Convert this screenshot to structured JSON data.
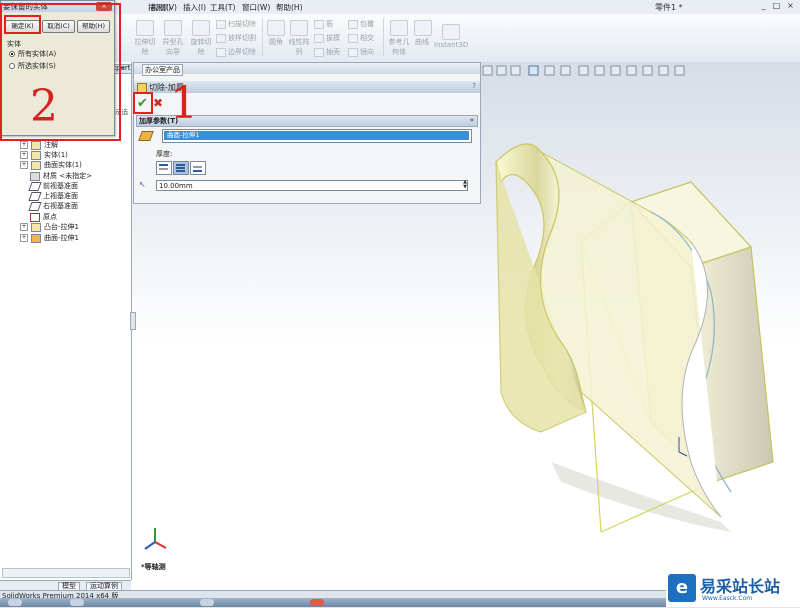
{
  "menubar": {
    "items": [
      "插入(I)",
      "视图(V)",
      "插入(I)",
      "工具(T)",
      "窗口(W)",
      "帮助(H)"
    ],
    "window_title": "零件1 *",
    "controls": [
      "_",
      "□",
      "×"
    ]
  },
  "ribbon": {
    "buttons": [
      "拉伸切除",
      "异型孔向导",
      "旋转切除",
      "圆角",
      "线性阵列",
      "参考几何体",
      "曲线",
      "Instant3D"
    ],
    "small_buttons": [
      "扫描切除",
      "放样切割",
      "边界切除",
      "筋",
      "拔模",
      "抽壳",
      "包覆",
      "相交",
      "镜向"
    ]
  },
  "dialog": {
    "title": "要保留的实体",
    "ok_label": "确定(K)",
    "cancel_label": "取消(C)",
    "help_label": "帮助(H)",
    "group_label": "实体",
    "option_all": "所有实体(A)",
    "option_selected": "所选实体(S)"
  },
  "left_panel": {
    "tabs_partial": [
      "xpert",
      "办公室产品"
    ],
    "side_label": "示选",
    "tree": [
      "注解",
      "实体(1)",
      "曲面实体(1)",
      "材质 <未指定>",
      "前视基准面",
      "上视基准面",
      "右视基准面",
      "原点",
      "凸台-拉伸1",
      "曲面-拉伸1"
    ],
    "bottom_tabs": [
      "模型",
      "运动算例"
    ]
  },
  "property_manager": {
    "title": "切除-加厚",
    "help": "?",
    "section_title": "加厚参数(T)",
    "collapse": "«",
    "selected_face": "曲面-拉伸1",
    "thickness_label": "厚度:",
    "depth_value": "10.00mm"
  },
  "viewport": {
    "view_label": "*等轴测"
  },
  "annotations": {
    "number_1": "1",
    "number_2": "2"
  },
  "status_bar": {
    "text": "SolidWorks Premium 2014 x64 版"
  },
  "watermark": {
    "text": "易采站长站",
    "sub": "Www.Easck.Com"
  },
  "colors": {
    "accent_red": "#e0211f",
    "selection_blue": "#3b8fd6",
    "model_yellow": "#e8e6b0",
    "part_gray": "#c8c6c2"
  }
}
